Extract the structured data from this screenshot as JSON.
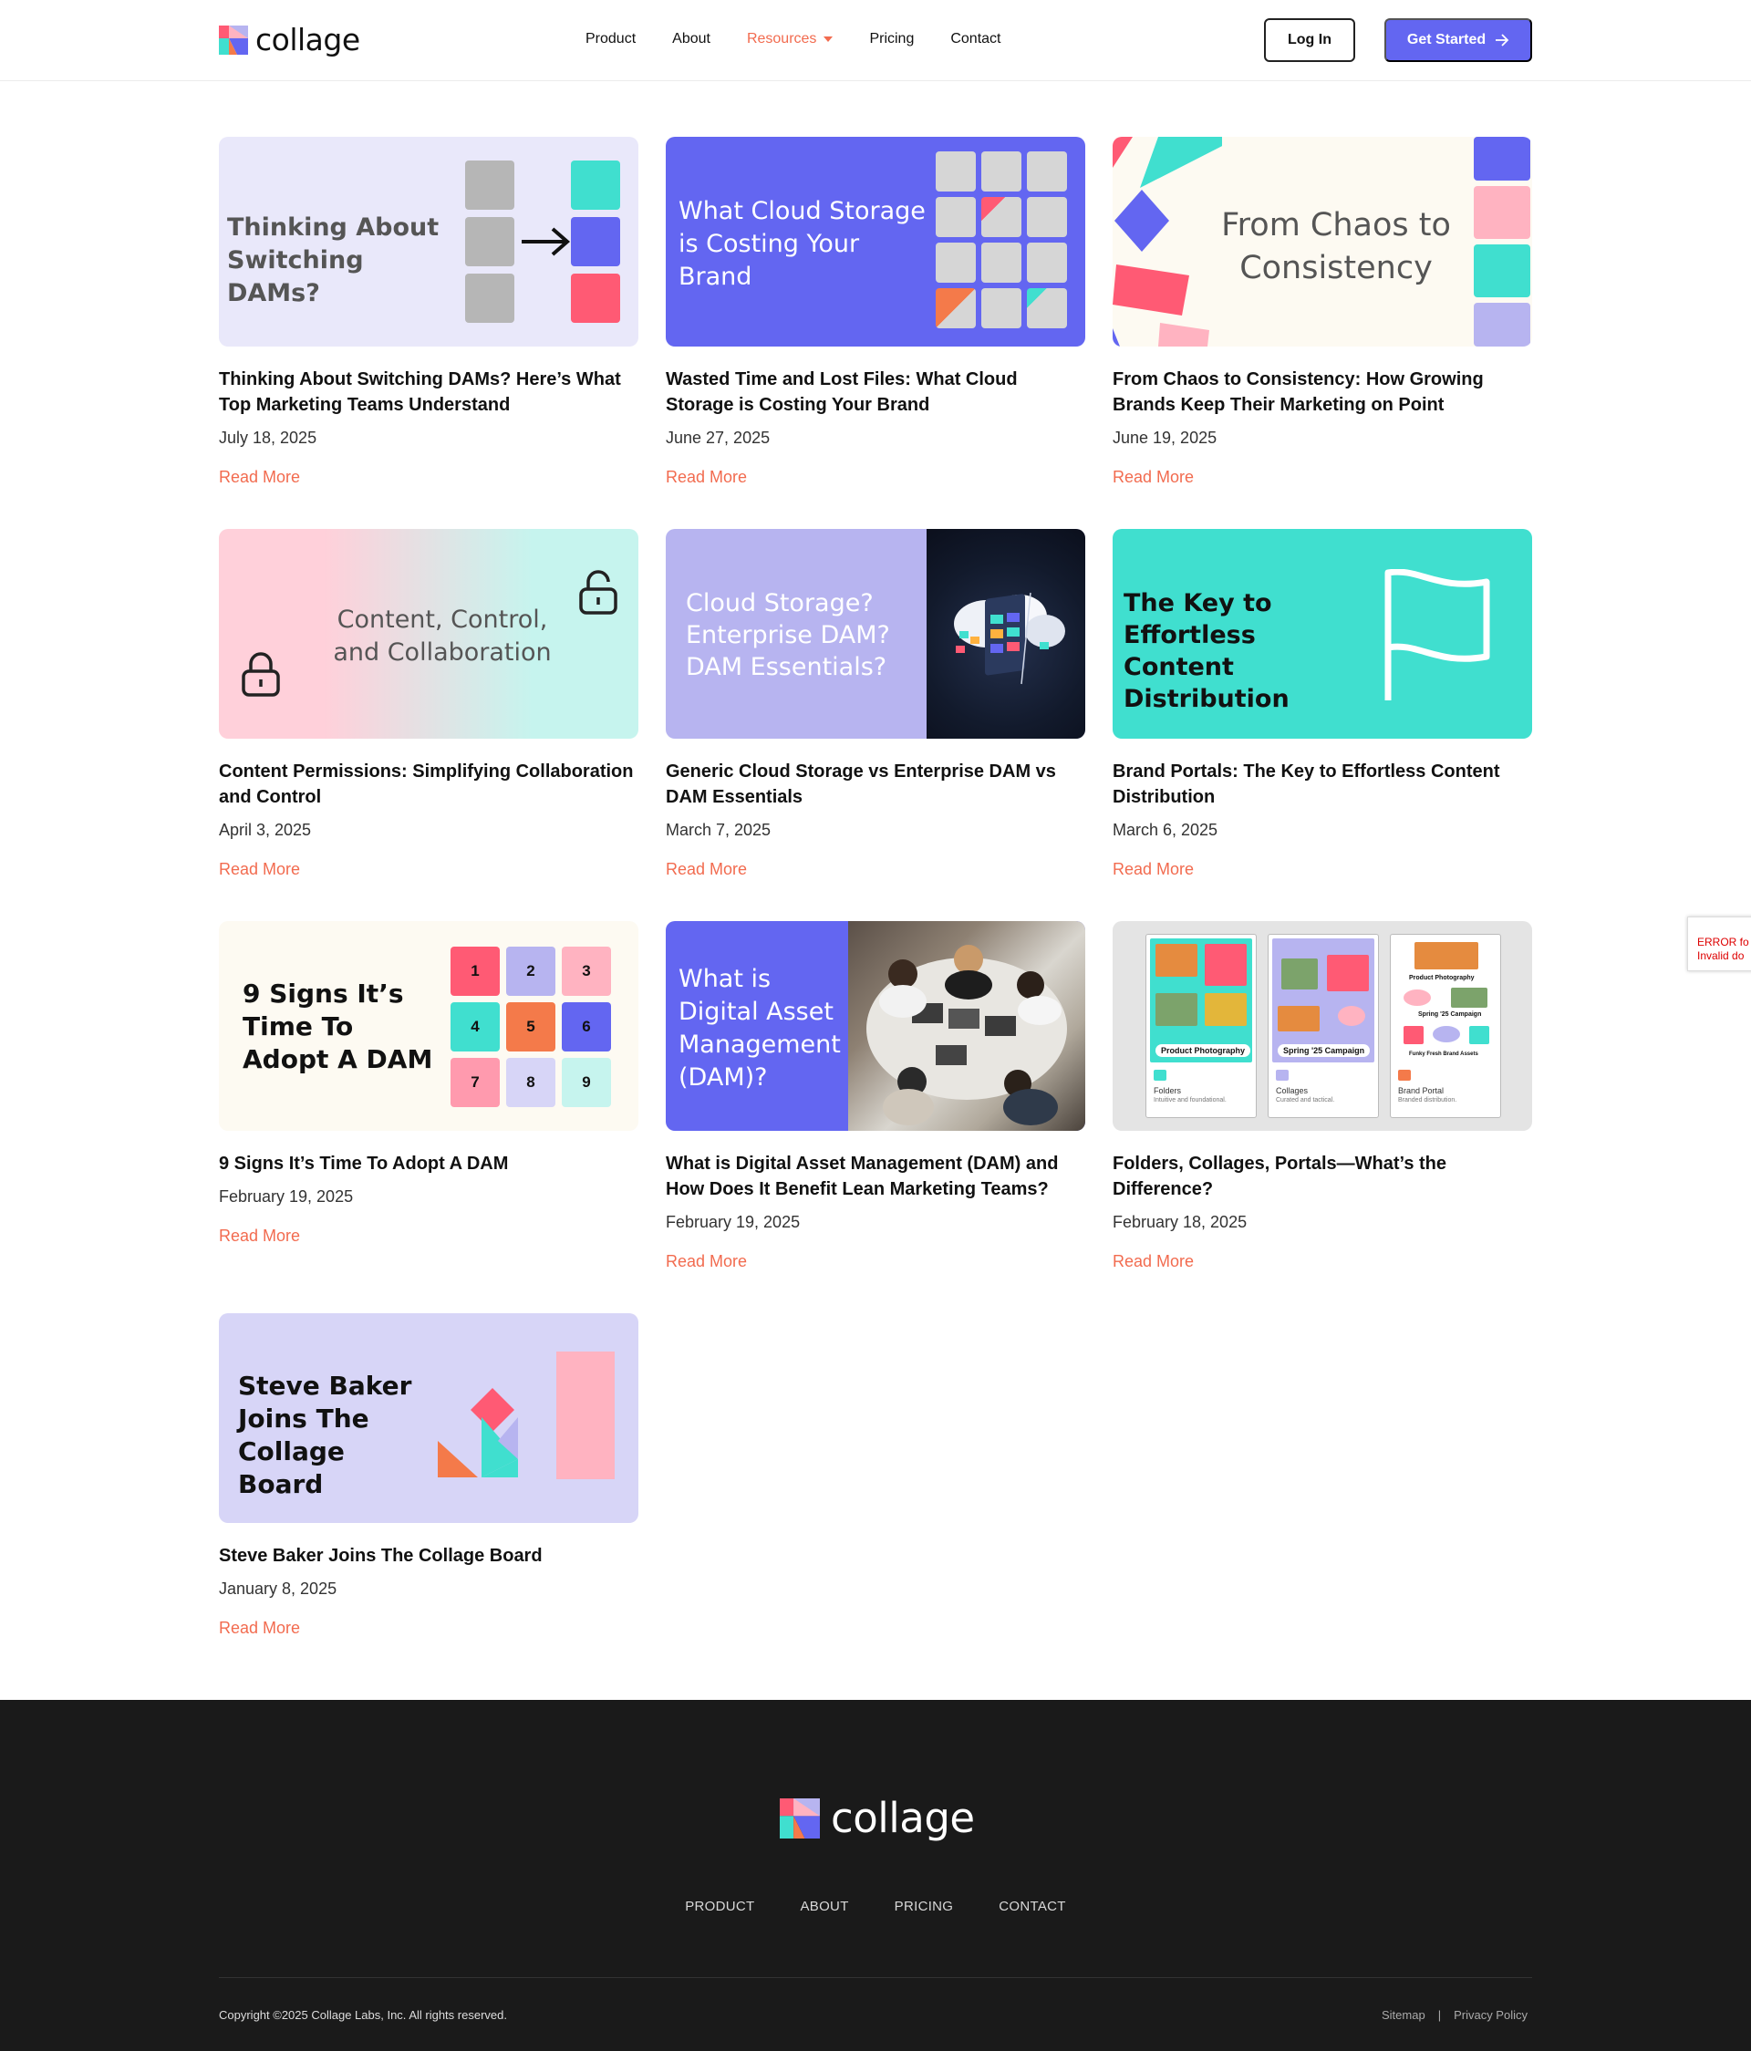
{
  "brand": {
    "name": "collage"
  },
  "nav": {
    "items": [
      {
        "label": "Product"
      },
      {
        "label": "About"
      },
      {
        "label": "Resources"
      },
      {
        "label": "Pricing"
      },
      {
        "label": "Contact"
      }
    ],
    "login_label": "Log In",
    "cta_label": "Get Started"
  },
  "posts": [
    {
      "thumb_text": "Thinking About Switching DAMs?",
      "title": "Thinking About Switching DAMs? Here’s What Top Marketing Teams Understand",
      "date": "July 18, 2025",
      "link": "Read More"
    },
    {
      "thumb_text": "What Cloud Storage is Costing Your Brand",
      "title": "Wasted Time and Lost Files: What Cloud Storage is Costing Your Brand",
      "date": "June 27, 2025",
      "link": "Read More"
    },
    {
      "thumb_text": "From Chaos to Consistency",
      "title": "From Chaos to Consistency: How Growing Brands Keep Their Marketing on Point",
      "date": "June 19, 2025",
      "link": "Read More"
    },
    {
      "thumb_text": "Content, Control, and Collaboration",
      "title": "Content Permissions: Simplifying Collaboration and Control",
      "date": "April 3, 2025",
      "link": "Read More"
    },
    {
      "thumb_text": "Cloud Storage? Enterprise DAM? DAM Essentials?",
      "title": "Generic Cloud Storage vs Enterprise DAM vs DAM Essentials",
      "date": "March 7, 2025",
      "link": "Read More"
    },
    {
      "thumb_text": "The Key to Effortless Content Distribution",
      "title": "Brand Portals: The Key to Effortless Content Distribution",
      "date": "March 6, 2025",
      "link": "Read More"
    },
    {
      "thumb_text": "9 Signs It’s Time To Adopt A DAM",
      "title": "9 Signs It’s Time To Adopt A DAM",
      "date": "February 19, 2025",
      "link": "Read More"
    },
    {
      "thumb_text": "What is Digital Asset Management (DAM)?",
      "title": "What is Digital Asset Management (DAM) and How Does It Benefit Lean Marketing Teams?",
      "date": "February 19, 2025",
      "link": "Read More"
    },
    {
      "thumb_text": "",
      "title": "Folders, Collages, Portals—What’s the Difference?",
      "date": "February 18, 2025",
      "link": "Read More"
    },
    {
      "thumb_text": "Steve Baker Joins The Collage Board",
      "title": "Steve Baker Joins The Collage Board",
      "date": "January 8, 2025",
      "link": "Read More"
    }
  ],
  "thumb_details": {
    "nine_signs_numbers": [
      "1",
      "2",
      "3",
      "4",
      "5",
      "6",
      "7",
      "8",
      "9"
    ],
    "portals_cards": [
      {
        "label": "Product Photography",
        "name": "Folders",
        "desc": "Intuitive and foundational."
      },
      {
        "label": "Spring '25 Campaign",
        "name": "Collages",
        "desc": "Curated and tactical."
      },
      {
        "label": "Funky Fresh Brand Assets",
        "name": "Brand Portal",
        "desc": "Branded distribution."
      }
    ]
  },
  "footer": {
    "nav": [
      "PRODUCT",
      "ABOUT",
      "PRICING",
      "CONTACT"
    ],
    "copyright": "Copyright ©2025 Collage Labs, Inc. All rights reserved.",
    "sitemap": "Sitemap",
    "separator": "|",
    "privacy": "Privacy Policy"
  },
  "recaptcha": {
    "line1": "ERROR fo",
    "line2": "Invalid do"
  },
  "colors": {
    "accent": "#f26b4f",
    "primary": "#6366f1",
    "teal": "#40dfcf",
    "lavender": "#b7b4f0",
    "pink": "#ff5a74",
    "footer_bg": "#1a1a1a"
  }
}
